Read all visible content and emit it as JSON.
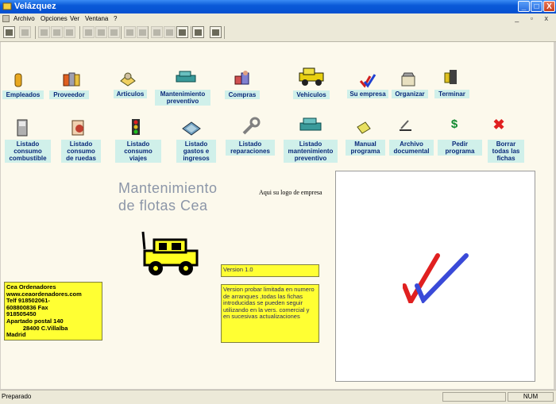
{
  "window": {
    "title": "Velázquez"
  },
  "menu": [
    "Archivo",
    "Opciones",
    "Ver",
    "Ventana",
    "?"
  ],
  "window_buttons": {
    "minimize": "_",
    "maximize": "□",
    "close": "X"
  },
  "mdi_controls": "_ ▫ x",
  "toolbar_icons": [
    "open-folder-icon",
    "save-icon",
    "cut-icon",
    "copy-icon",
    "paste-icon",
    "print-icon",
    "print-preview-icon",
    "find-icon",
    "zoom-icon",
    "tool-a-icon",
    "tool-b-icon",
    "tool-c-icon",
    "window-icon",
    "diamond-icon",
    "help-icon"
  ],
  "row1": [
    {
      "label": "Empleados",
      "icon": "employee-icon"
    },
    {
      "label": "Proveedor",
      "icon": "supplier-icon"
    },
    {
      "label": "Articulos",
      "icon": "articles-icon"
    },
    {
      "label": "Mantenimiento preventivo",
      "icon": "maintenance-icon"
    },
    {
      "label": "Compras",
      "icon": "purchases-icon"
    },
    {
      "label": "Vehiculos",
      "icon": "vehicle-icon"
    },
    {
      "label": "Su empresa",
      "icon": "company-icon"
    },
    {
      "label": "Organizar",
      "icon": "organize-icon"
    },
    {
      "label": "Terminar",
      "icon": "exit-icon"
    }
  ],
  "row2": [
    {
      "label": "Listado consumo combustible",
      "icon": "fuel-icon"
    },
    {
      "label": "Listado consumo de ruedas",
      "icon": "wheels-icon"
    },
    {
      "label": "Listado consumo viajes",
      "icon": "traffic-light-icon"
    },
    {
      "label": "Listado gastos e ingresos",
      "icon": "money-icon"
    },
    {
      "label": "Listado reparaciones",
      "icon": "wrench-icon"
    },
    {
      "label": "Listado mantenimiento preventivo",
      "icon": "maintenance-list-icon"
    },
    {
      "label": "Manual programa",
      "icon": "manual-icon"
    },
    {
      "label": "Archivo documental",
      "icon": "archive-icon"
    },
    {
      "label": "Pedir programa",
      "icon": "dollar-icon"
    },
    {
      "label": "Borrar todas las fichas",
      "icon": "delete-icon"
    }
  ],
  "app_logo": {
    "line1": "Mantenimiento",
    "line2": "de flotas   Cea"
  },
  "logo_caption": "Aqui su logo de empresa",
  "version": "Version 1.0",
  "notice": "Version probar limitada en numero de arranques ,todas las fichas introducidas se pueden seguir utilizando en la vers. comercial y en sucesivas actualizaciones",
  "contact": [
    "Cea Ordenadores",
    "www.ceaordenadores.com",
    "Telf 918502061-",
    "608800836  Fax",
    "918505450",
    "Apartado postal 140",
    "          28400 C.Villalba",
    "Madrid"
  ],
  "status": {
    "text": "Preparado",
    "num": "NUM"
  },
  "colors": {
    "label_bg": "#d0f0ea",
    "label_text": "#0a2a7a",
    "note_bg": "#ffff33",
    "client_bg": "#fcf9ec"
  }
}
